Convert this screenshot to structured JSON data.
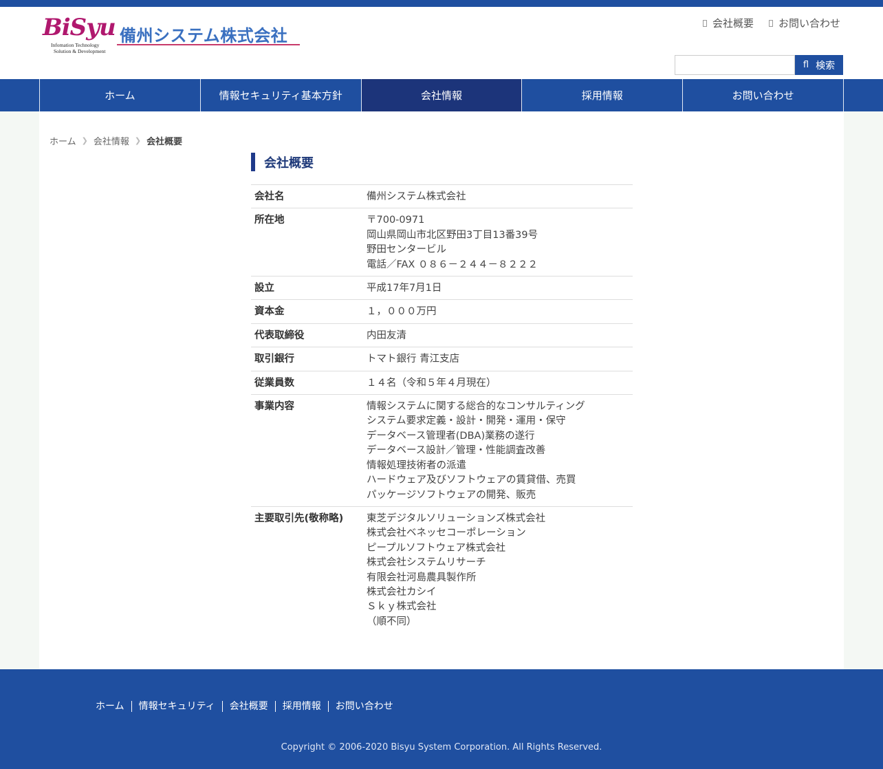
{
  "logo": {
    "script": "BiSyu",
    "tagline1": "Infomation Technology",
    "tagline2": "Solution & Development",
    "company_name": "備州システム株式会社"
  },
  "top_links": [
    {
      "label": "会社概要"
    },
    {
      "label": "お問い合わせ"
    }
  ],
  "search": {
    "placeholder": "",
    "button_icon": "fl",
    "button_label": "検索"
  },
  "nav": {
    "items": [
      {
        "label": "ホーム"
      },
      {
        "label": "情報セキュリティ基本方針"
      },
      {
        "label": "会社情報"
      },
      {
        "label": "採用情報"
      },
      {
        "label": "お問い合わせ"
      }
    ],
    "active_index": 2
  },
  "breadcrumb": {
    "items": [
      "ホーム",
      "会社情報"
    ],
    "current": "会社概要"
  },
  "page_title": "会社概要",
  "company_info": [
    {
      "label": "会社名",
      "lines": [
        "備州システム株式会社"
      ]
    },
    {
      "label": "所在地",
      "lines": [
        "〒700-0971",
        "岡山県岡山市北区野田3丁目13番39号",
        "野田センタービル",
        "電話／FAX ０８６－２４４－８２２２"
      ]
    },
    {
      "label": "設立",
      "lines": [
        "平成17年7月1日"
      ]
    },
    {
      "label": "資本金",
      "lines": [
        "１，０００万円"
      ]
    },
    {
      "label": "代表取締役",
      "lines": [
        "内田友清"
      ]
    },
    {
      "label": "取引銀行",
      "lines": [
        "トマト銀行 青江支店"
      ]
    },
    {
      "label": "従業員数",
      "lines": [
        "１４名（令和５年４月現在）"
      ]
    },
    {
      "label": "事業内容",
      "lines": [
        "情報システムに関する総合的なコンサルティング",
        "システム要求定義・設計・開発・運用・保守",
        "データベース管理者(DBA)業務の遂行",
        "データベース設計／管理・性能調査改善",
        "情報処理技術者の派遣",
        "ハードウェア及びソフトウェアの賃貸借、売買",
        "パッケージソフトウェアの開発、販売"
      ]
    },
    {
      "label": "主要取引先(敬称略)",
      "lines": [
        "東芝デジタルソリューションズ株式会社",
        "株式会社ベネッセコーポレーション",
        "ピープルソフトウェア株式会社",
        "株式会社システムリサーチ",
        "有限会社河島農具製作所",
        "株式会社カシイ",
        "Ｓｋｙ株式会社",
        "（順不同）"
      ]
    }
  ],
  "footer": {
    "links": [
      "ホーム",
      "情報セキュリティ",
      "会社概要",
      "採用情報",
      "お問い合わせ"
    ],
    "copyright": "Copyright © 2006-2020 Bisyu System Corporation. All Rights Reserved."
  },
  "colors": {
    "brand_blue": "#1f4fa0",
    "nav_active": "#1c347a",
    "logo_magenta": "#b0186e"
  }
}
